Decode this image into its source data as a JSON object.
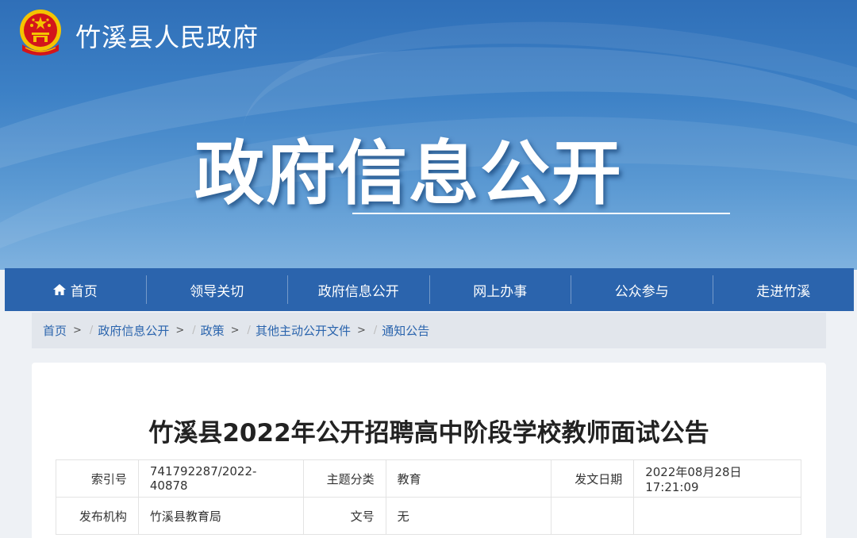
{
  "site": {
    "name": "竹溪县人民政府",
    "hero_title": "政府信息公开"
  },
  "nav": {
    "items": [
      {
        "label": "首页",
        "icon": "home-icon"
      },
      {
        "label": "领导关切"
      },
      {
        "label": "政府信息公开"
      },
      {
        "label": "网上办事"
      },
      {
        "label": "公众参与"
      },
      {
        "label": "走进竹溪"
      }
    ]
  },
  "breadcrumb": [
    {
      "label": "首页"
    },
    {
      "label": "政府信息公开"
    },
    {
      "label": "政策"
    },
    {
      "label": "其他主动公开文件"
    },
    {
      "label": "通知公告"
    }
  ],
  "breadcrumb_sep": ">",
  "article": {
    "title": "竹溪县2022年公开招聘高中阶段学校教师面试公告",
    "meta": {
      "index_label": "索引号",
      "index_value": "741792287/2022-40878",
      "topic_label": "主题分类",
      "topic_value": "教育",
      "date_label": "发文日期",
      "date_value": "2022年08月28日 17:21:09",
      "org_label": "发布机构",
      "org_value": "竹溪县教育局",
      "docno_label": "文号",
      "docno_value": "无"
    }
  },
  "colors": {
    "nav_bg": "#2b64ad",
    "link": "#2a64ad",
    "emblem_red": "#d3151b",
    "emblem_gold": "#f4c400"
  }
}
